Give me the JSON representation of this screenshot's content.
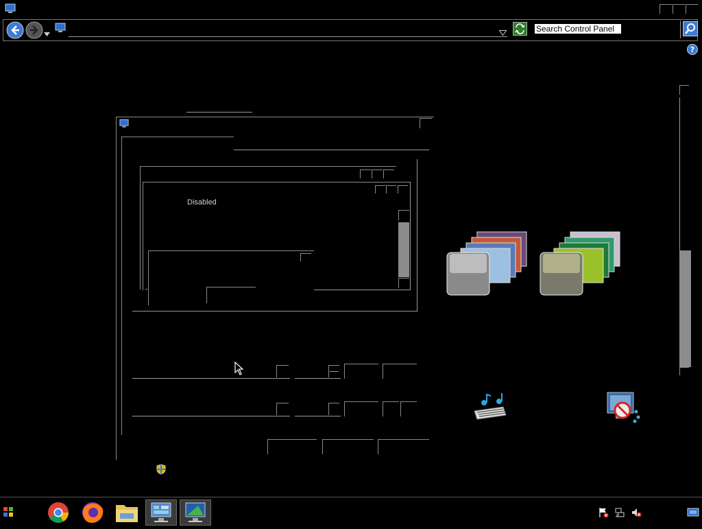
{
  "window": {
    "title_icon": "monitor-icon"
  },
  "addressbar": {
    "dropdown_icon": "chevron-down-icon",
    "refresh_icon": "refresh-icon"
  },
  "search": {
    "value": "Search Control Panel",
    "icon": "search-icon"
  },
  "help": {
    "icon": "help-icon"
  },
  "dialog": {
    "status_text": "Disabled"
  },
  "tiles": [
    {
      "name": "theme-thumbnail-1",
      "icon": "photo-stack-icon"
    },
    {
      "name": "theme-thumbnail-2",
      "icon": "photo-stack-icon"
    },
    {
      "name": "sounds",
      "icon": "music-notes-icon"
    },
    {
      "name": "screen-saver",
      "icon": "screensaver-icon"
    }
  ],
  "taskbar": {
    "start_icon": "windows-logo-icon",
    "apps": [
      {
        "name": "chrome",
        "icon": "chrome-icon"
      },
      {
        "name": "firefox",
        "icon": "firefox-icon"
      },
      {
        "name": "explorer",
        "icon": "folder-icon"
      },
      {
        "name": "control-panel",
        "icon": "control-panel-icon"
      },
      {
        "name": "display-settings",
        "icon": "monitor-icon"
      }
    ],
    "tray": [
      "action-center-icon",
      "network-icon",
      "volume-muted-icon",
      "show-desktop-icon"
    ]
  },
  "colors": {
    "background": "#000000",
    "outline": "#8a8a8a",
    "accent": "#3a7bd5"
  }
}
